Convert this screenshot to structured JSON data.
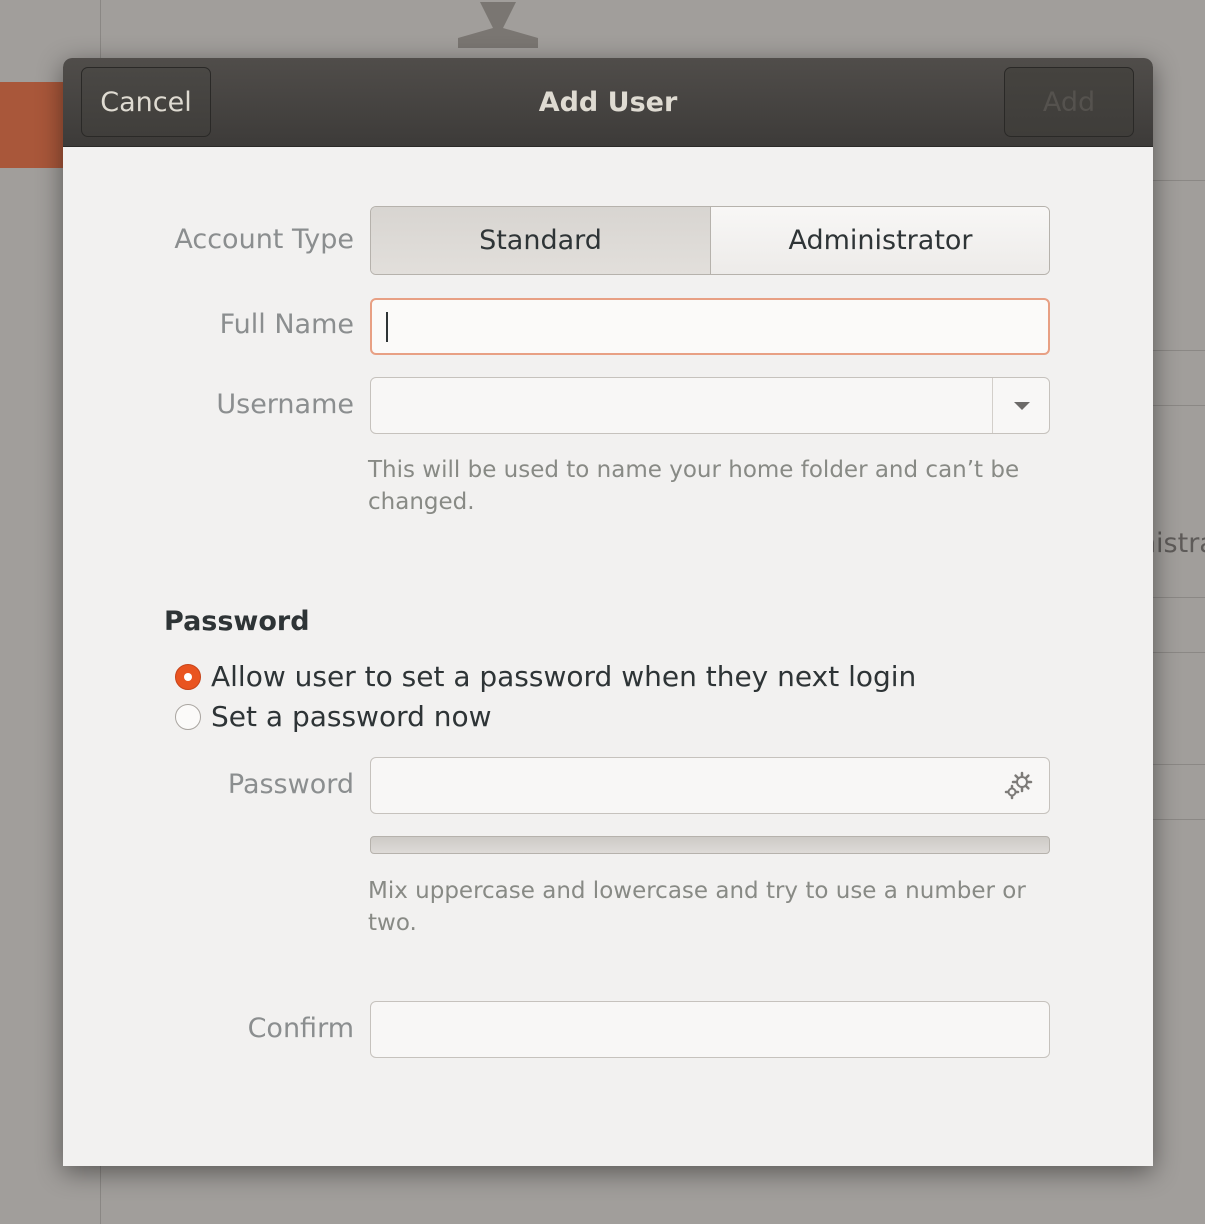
{
  "dialog": {
    "title": "Add User",
    "cancel_label": "Cancel",
    "add_label": "Add"
  },
  "account_type": {
    "label": "Account Type",
    "options": [
      "Standard",
      "Administrator"
    ],
    "selected": "Standard"
  },
  "full_name": {
    "label": "Full Name",
    "value": ""
  },
  "username": {
    "label": "Username",
    "value": "",
    "hint": "This will be used to name your home folder and can’t be changed."
  },
  "password_section": {
    "title": "Password",
    "options": [
      {
        "label": "Allow user to set a password when they next login",
        "selected": true
      },
      {
        "label": "Set a password now",
        "selected": false
      }
    ],
    "password_label": "Password",
    "strength": 0,
    "hint": "Mix uppercase and lowercase and try to use a number or two.",
    "confirm_label": "Confirm"
  },
  "background": {
    "partial_text": "Administrator"
  },
  "colors": {
    "accent": "#e95420",
    "headerbar": "#45433f",
    "dialog_bg": "#f2f1f0",
    "focus_border": "#e8a084"
  }
}
